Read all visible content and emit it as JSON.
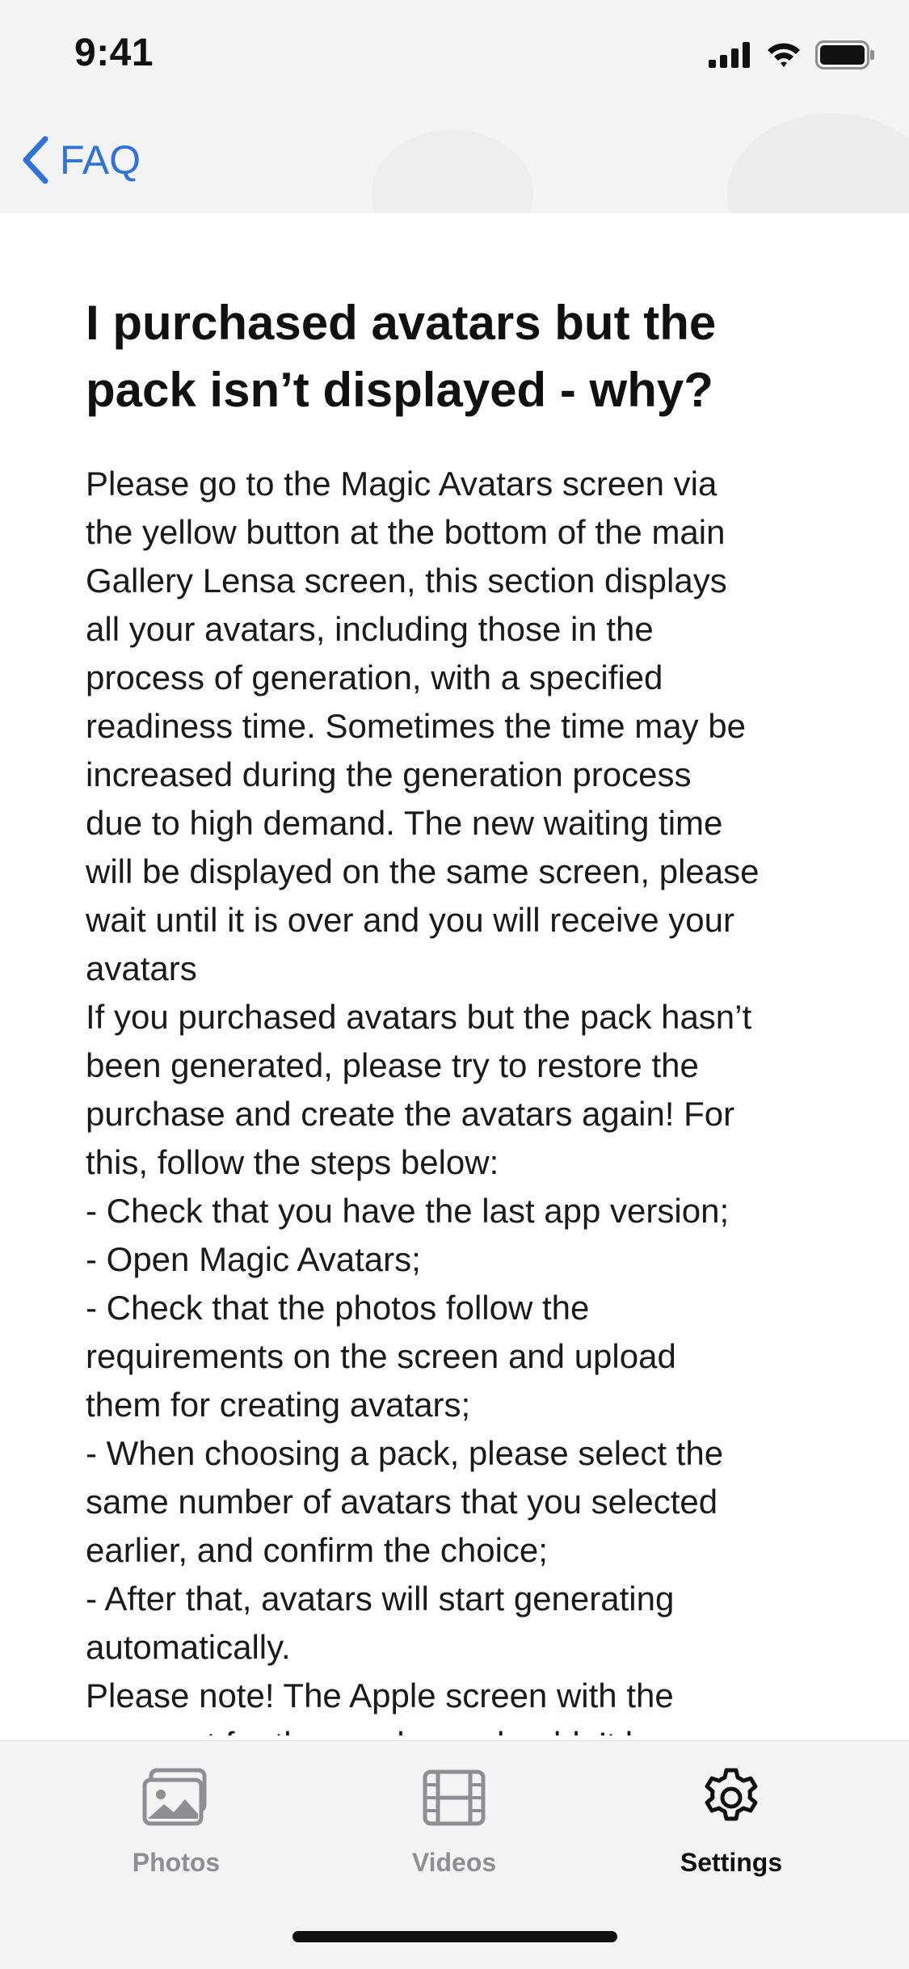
{
  "status_bar": {
    "time": "9:41"
  },
  "nav": {
    "back_label": "FAQ"
  },
  "article": {
    "title_lines": [
      "I purchased avatars but the",
      "pack isn’t displayed - why?"
    ],
    "lines": [
      "Please go to the Magic Avatars screen via",
      "the yellow button at the bottom of the main",
      "Gallery Lensa screen, this section displays",
      "all your avatars, including those in the",
      "process of generation, with a specified",
      "readiness time. Sometimes the time may be",
      "increased during the generation process",
      "due to high demand. The new waiting time",
      "will be displayed on the same screen, please",
      "wait until it is over and you will receive your",
      "avatars",
      "If you purchased avatars but the pack hasn’t",
      "been generated, please try to restore the",
      "purchase and create the avatars again! For",
      "this, follow the steps below:",
      "- Check that you have the last app version;",
      "- Open Magic Avatars;",
      "- Check that the photos follow the",
      "requirements on the screen and upload",
      "them for creating avatars;",
      "- When choosing a pack, please select the",
      "same number of avatars that you selected",
      "earlier, and confirm the choice;",
      "- After that, avatars will start generating",
      "automatically.",
      "Please note! The Apple screen with the",
      "payment for the purchase shouldn’t be"
    ]
  },
  "tabs": [
    {
      "label": "Photos",
      "icon": "photos-icon",
      "active": false
    },
    {
      "label": "Videos",
      "icon": "film-icon",
      "active": false
    },
    {
      "label": "Settings",
      "icon": "gear-icon",
      "active": true
    }
  ],
  "colors": {
    "accent": "#2f73d8",
    "inactive": "#8e8e93",
    "bar_bg": "#f4f4f5"
  }
}
